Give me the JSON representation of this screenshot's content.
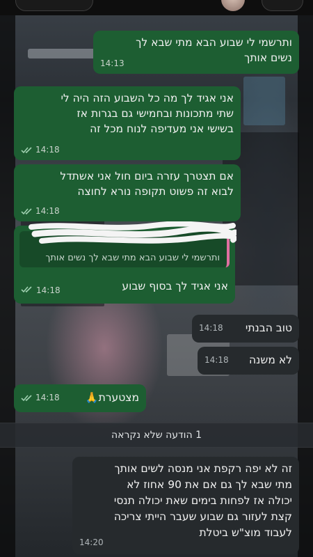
{
  "messages": [
    {
      "id": "m1",
      "direction": "outgoing",
      "text": "ותרשמי לי שבוע הבא מתי שבא לך\nנשים אותך",
      "time": "14:13"
    },
    {
      "id": "m2",
      "direction": "outgoing",
      "text": "אני אגיד לך מה כל השבוע הזה היה לי\nשתי מתכונות ובחמישי גם בגרות אז\nבשישי אני מעדיפה לנוח מכל זה",
      "time": "14:18",
      "ticks": "read"
    },
    {
      "id": "m3",
      "direction": "outgoing",
      "text": "אם תצטרך עזרה ביום חול אני אשתדל\nלבוא זה פשוט תקופה נורא לחוצה",
      "time": "14:18",
      "ticks": "read"
    },
    {
      "id": "m4",
      "direction": "outgoing",
      "quoted_text": "ותרשמי לי שבוע הבא מתי שבא לך נשים אותך",
      "text": "אני אגיד לך בסוף שבוע",
      "time": "14:18",
      "ticks": "read"
    },
    {
      "id": "m5",
      "direction": "incoming",
      "text": "טוב הבנתי",
      "time": "14:18"
    },
    {
      "id": "m6",
      "direction": "incoming",
      "text": "לא משנה",
      "time": "14:18"
    },
    {
      "id": "m7",
      "direction": "outgoing",
      "text": "מצטערת",
      "emoji": "🙏",
      "time": "14:18",
      "ticks": "read"
    },
    {
      "id": "m8",
      "direction": "incoming",
      "text": "זה לא יפה רקפת אני מנסה לשים אותך\nמתי שבא לך גם אם את 90 אחוז לא\nיכולה אז לפחות בימים שאת יכולה תנסי\nקצת לעזור גם שבוע שעבר הייתי צריכה\nלעבוד מוצ\"ש ביטלת",
      "time": "14:20"
    }
  ],
  "unread_divider": "1 הודעה שלא נקראה",
  "colors": {
    "outgoing_bubble": "#1d5e32",
    "incoming_bubble": "#262a2d",
    "read_ticks": "#9fd0b0",
    "quote_bar": "#e06fa0"
  },
  "icons": {
    "read_ticks": "double-check-icon",
    "back": "chevron-icon"
  }
}
